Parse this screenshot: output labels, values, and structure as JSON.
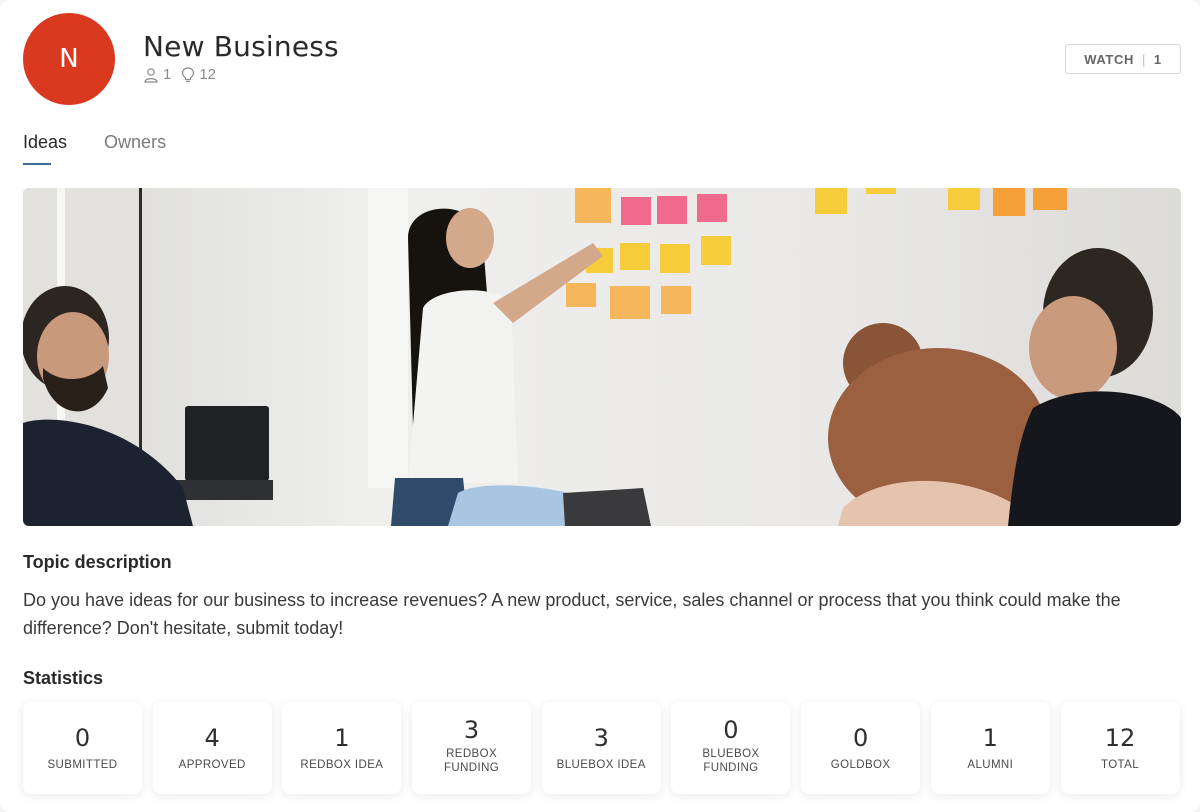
{
  "topic": {
    "avatar_letter": "N",
    "avatar_color": "#d93a1f",
    "title": "New Business",
    "owners_count": "1",
    "ideas_count": "12",
    "owners_icon": "person-icon",
    "ideas_icon": "lightbulb-icon"
  },
  "watch": {
    "label": "WATCH",
    "count": "1"
  },
  "tabs": [
    {
      "label": "Ideas",
      "active": true
    },
    {
      "label": "Owners",
      "active": false
    }
  ],
  "hero_image": {
    "description": "team meeting with sticky notes on wall"
  },
  "description": {
    "heading": "Topic description",
    "text": "Do you have ideas for our business to increase revenues? A new product, service, sales channel or process that you think could make the difference? Don't hesitate, submit today!"
  },
  "statistics": {
    "heading": "Statistics",
    "items": [
      {
        "value": "0",
        "label": "SUBMITTED"
      },
      {
        "value": "4",
        "label": "APPROVED"
      },
      {
        "value": "1",
        "label": "REDBOX IDEA"
      },
      {
        "value": "3",
        "label": "REDBOX FUNDING"
      },
      {
        "value": "3",
        "label": "BLUEBOX IDEA"
      },
      {
        "value": "0",
        "label": "BLUEBOX FUNDING"
      },
      {
        "value": "0",
        "label": "GOLDBOX"
      },
      {
        "value": "1",
        "label": "ALUMNI"
      },
      {
        "value": "12",
        "label": "TOTAL"
      }
    ]
  },
  "colors": {
    "accent": "#3b6d9a",
    "background": "#f4f4f6"
  }
}
